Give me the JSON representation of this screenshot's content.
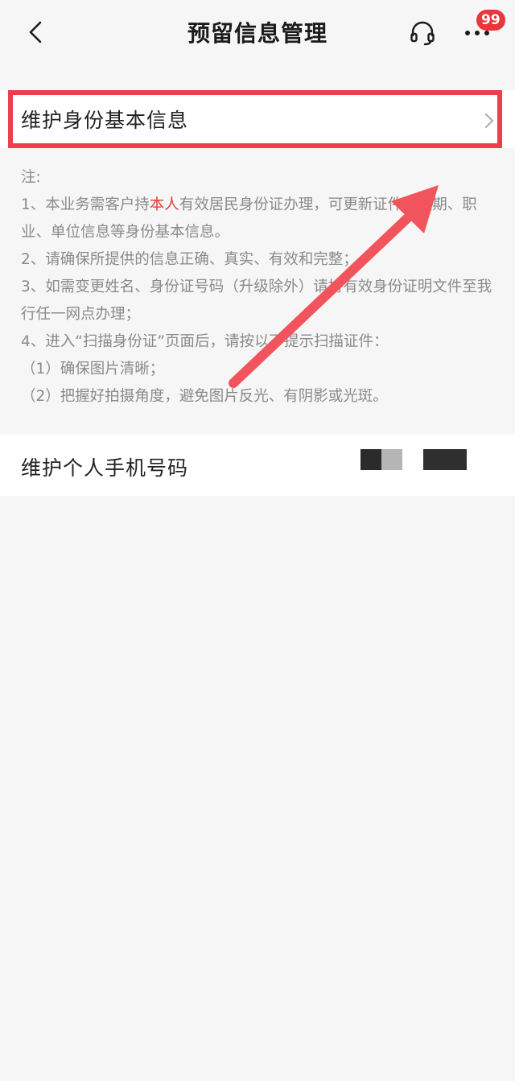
{
  "header": {
    "title": "预留信息管理",
    "badge": "99"
  },
  "rows": {
    "identity_label": "维护身份基本信息",
    "phone_label": "维护个人手机号码"
  },
  "notes": {
    "heading": "注:",
    "item1_pre": "1、本业务需客户持",
    "item1_em": "本人",
    "item1_post": "有效居民身份证办理，可更新证件有效期、职业、单位信息等身份基本信息。",
    "item2": "2、请确保所提供的信息正确、真实、有效和完整；",
    "item3": "3、如需变更姓名、身份证号码（升级除外）请持有效身份证明文件至我行任一网点办理；",
    "item4": "4、进入“扫描身份证”页面后，请按以下提示扫描证件：",
    "item4_1": "（1）确保图片清晰；",
    "item4_2": "（2）把握好拍摄角度，避免图片反光、有阴影或光斑。"
  },
  "colors": {
    "highlight": "#ef3d4c",
    "badge": "#e8363c",
    "emphasis": "#e23b3b"
  },
  "icons": {
    "back": "chevron-left-icon",
    "support": "headset-icon",
    "more": "more-dots-icon",
    "row_chevron": "chevron-right-icon"
  }
}
